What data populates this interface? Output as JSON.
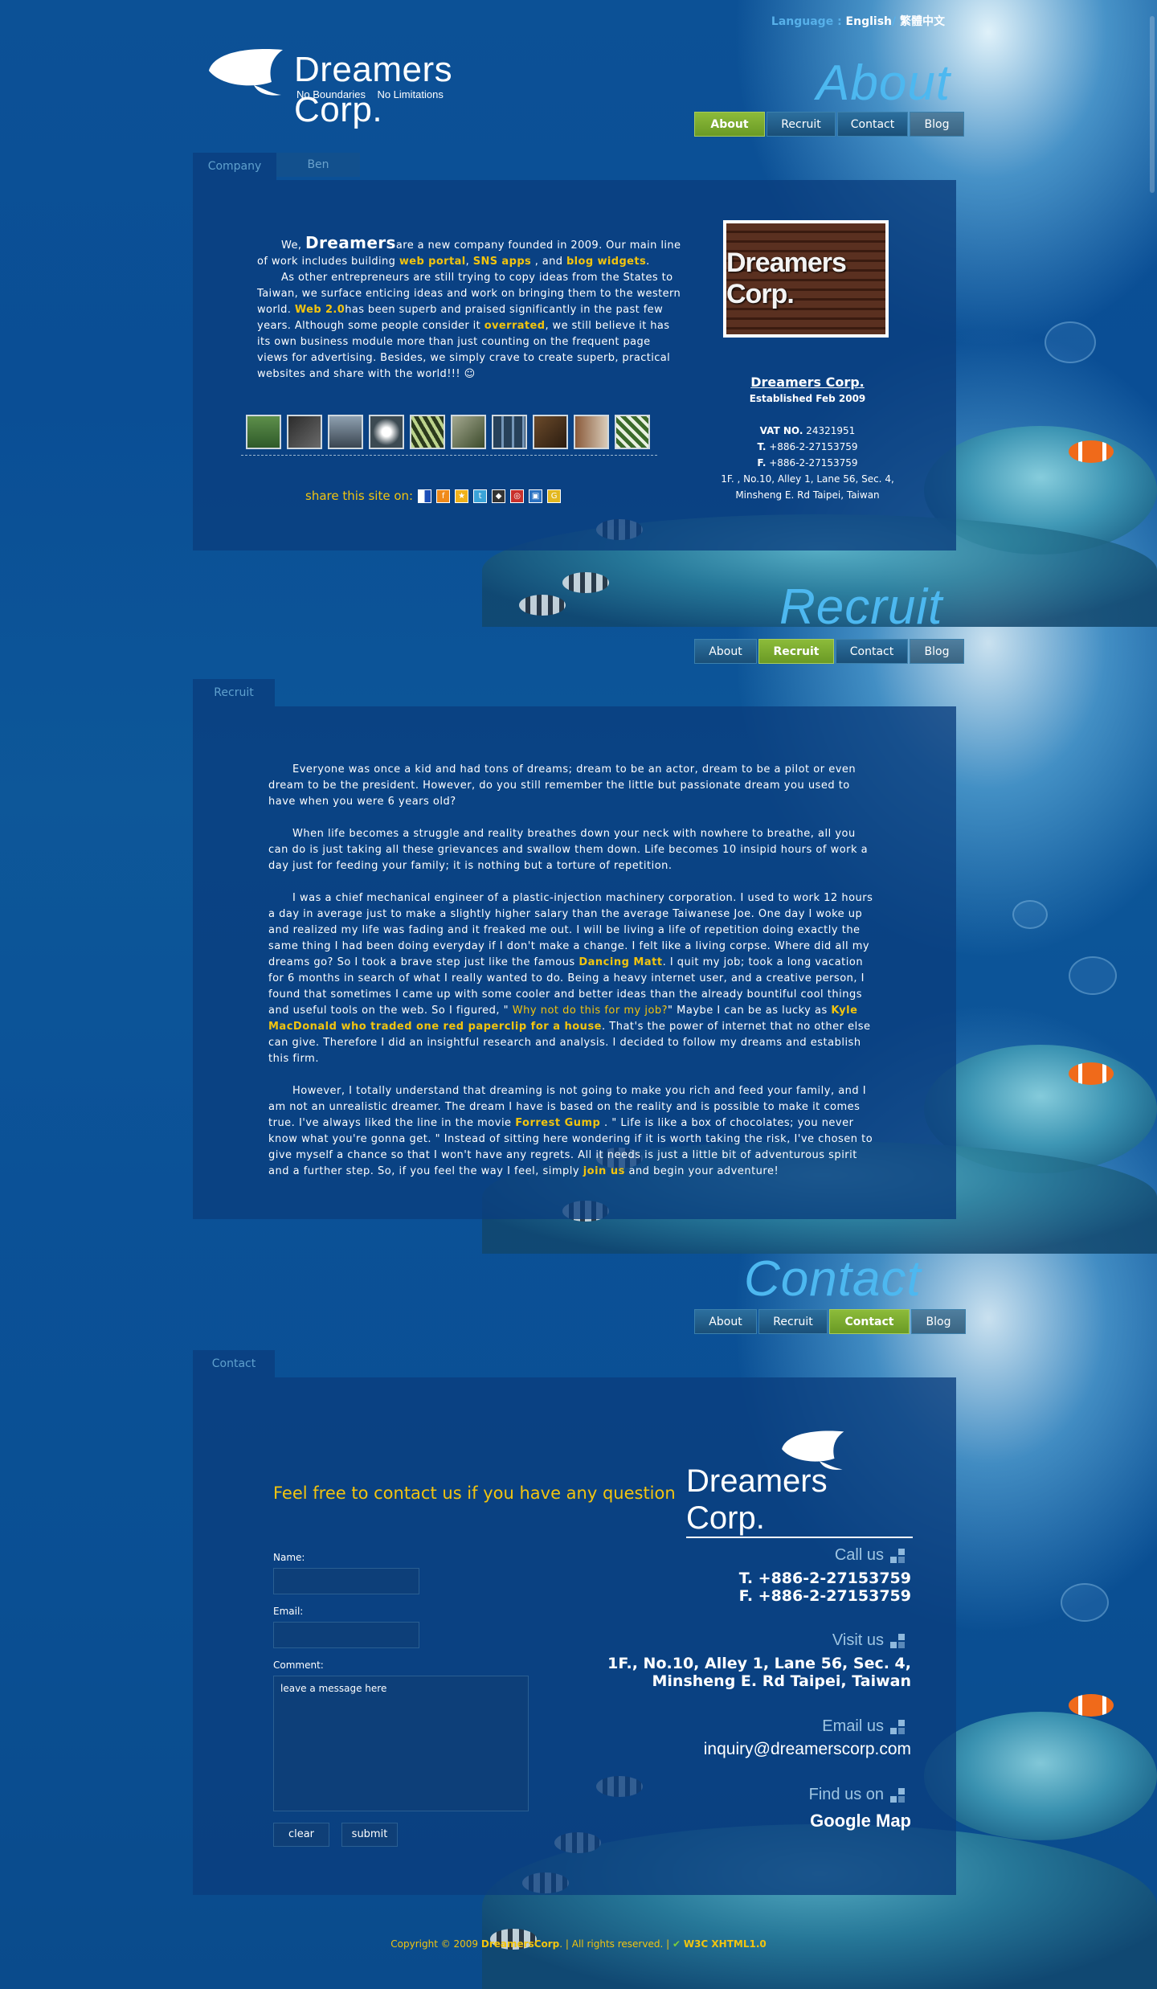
{
  "lang": {
    "prefix": "Language : ",
    "english": "English",
    "sep": "/",
    "chinese": "繁體中文"
  },
  "logo": {
    "name": "Dreamers Corp.",
    "tagline": "No Boundaries    No Limitations"
  },
  "titles": {
    "about": "About",
    "recruit": "Recruit",
    "contact": "Contact"
  },
  "nav": {
    "about": "About",
    "recruit": "Recruit",
    "contact": "Contact",
    "blog": "Blog"
  },
  "about": {
    "tabs": [
      "Company",
      "Ben"
    ],
    "p1_a": "We, ",
    "p1_brand": "Dreamers",
    "p1_b": "are a new company founded in 2009. Our main line of work includes building ",
    "p1_l1": "web portal",
    "p1_c": ", ",
    "p1_l2": "SNS apps",
    "p1_d": " , and ",
    "p1_l3": "blog widgets",
    "p1_e": ".",
    "p2_a": "As other entrepreneurs are still trying to copy ideas from the States to Taiwan, we surface enticing ideas and work on bringing them to the western world. ",
    "p2_l1": "Web 2.0",
    "p2_b": "has been superb and praised significantly in the past few years. Although some people consider it ",
    "p2_l2": "overrated",
    "p2_c": ", we still believe it has its own business module more than just counting on the frequent page views for advertising. Besides, we simply crave to create superb, practical websites and share with the world!!! ☺",
    "photo_text": "Dreamers Corp.",
    "company": {
      "name": "Dreamers Corp.",
      "established": "Established Feb 2009",
      "vat_label": "VAT NO.",
      "vat": " 24321951",
      "t_label": "T.",
      "t": " +886-2-27153759",
      "f_label": "F.",
      "f": " +886-2-27153759",
      "addr1": "1F. , No.10, Alley 1, Lane 56, Sec. 4,",
      "addr2": "Minsheng E. Rd Taipei, Taiwan"
    },
    "share_label": "share this site on:"
  },
  "recruit": {
    "tab": "Recruit",
    "p1": "Everyone was once a kid and had tons of dreams; dream to be an actor, dream to be a pilot or even dream to be the president. However, do you still remember the little but passionate dream you used to have when you were 6 years old?",
    "p2": "When life becomes a struggle and reality breathes down your neck with nowhere to breathe, all you can do is just taking all these grievances and swallow them down. Life becomes 10 insipid hours of work a day just for feeding your family; it is nothing but a torture of repetition.",
    "p3_a": "I was a chief mechanical engineer of a plastic-injection machinery corporation. I used to work 12 hours a day in average just to make a slightly higher salary than the average Taiwanese Joe. One day I woke up and realized my life was fading and it freaked me out. I will be living a life of repetition doing exactly the same thing I had been doing everyday if I don't make a change. I felt like a living corpse. Where did all my dreams go? So I took a brave step just like the famous ",
    "p3_l1": "Dancing Matt",
    "p3_b": ". I quit my job; took a long vacation for 6 months in search of what I really wanted to do. Being a heavy internet user, and a creative person, I found that sometimes I came up with some cooler and better ideas than the already bountiful cool things and useful tools on the web. So I figured, \" ",
    "p3_q": "Why not do this for my job?",
    "p3_c": "\" Maybe I can be as lucky as ",
    "p3_l2": "Kyle MacDonald who traded one red paperclip for a house",
    "p3_d": ". That's the power of internet that no other else can give. Therefore I did an insightful research and analysis. I decided to follow my dreams and establish this firm.",
    "p4_a": "However, I totally understand that dreaming is not going to make you rich and feed your family, and I am not an unrealistic dreamer. The dream I have is based on the reality and is possible to make it comes true. I've always liked the line in the movie ",
    "p4_l1": "Forrest Gump",
    "p4_b": " . \" Life is like a box of chocolates; you never know what you're gonna get. \" Instead of sitting here wondering if it is worth taking the risk, I've chosen to give myself a chance so that I won't have any regrets. All it needs is just a little bit of adventurous spirit and a further step. So, if you feel the way I feel, simply ",
    "p4_l2": "join us",
    "p4_c": " and begin your adventure!"
  },
  "contact": {
    "tab": "Contact",
    "heading": "Feel free to contact us if you have any question",
    "name_label": "Name:",
    "email_label": "Email:",
    "comment_label": "Comment:",
    "comment_placeholder": "leave a message here",
    "clear": "clear",
    "submit": "submit",
    "logo_name": "Dreamers Corp.",
    "call_label": "Call us",
    "call_t": "T. +886-2-27153759",
    "call_f": "F. +886-2-27153759",
    "visit_label": "Visit us",
    "visit_1": "1F., No.10, Alley 1, Lane 56, Sec. 4,",
    "visit_2": "Minsheng E. Rd Taipei, Taiwan",
    "email_label2": "Email us",
    "email": "inquiry@dreamerscorp.com",
    "find_label": "Find us on",
    "map": "Google Map"
  },
  "footer": {
    "copy": "Copyright © 2009 ",
    "brand": "DreamersCorp",
    "rights": ". | All rights reserved. | ",
    "w3c": "W3C XHTML1.0"
  },
  "colors": {
    "accent": "#f2c40f",
    "nav_active": "#7aab2e",
    "title_blue": "#4db8f0",
    "panel": "#0a3e7d"
  }
}
